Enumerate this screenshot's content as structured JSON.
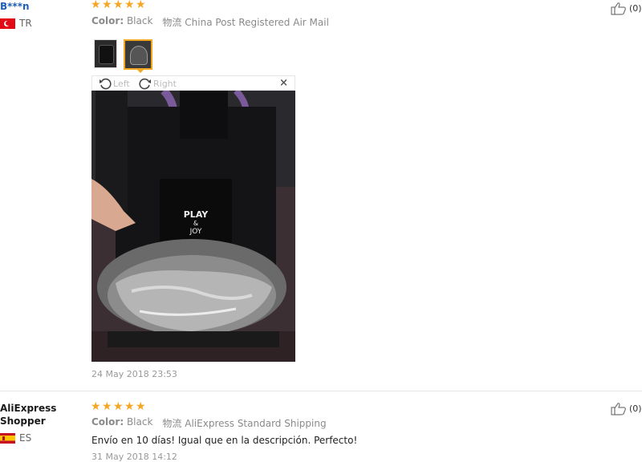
{
  "reviews": [
    {
      "user": "B***n",
      "country": "TR",
      "rating": 5,
      "color_label": "Color:",
      "color_value": "Black",
      "shipping_label": "物流",
      "shipping_value": "China Post Registered Air Mail",
      "rotate_left": "Left",
      "rotate_right": "Right",
      "close": "×",
      "photo_text": [
        "PLAY",
        "&",
        "JOY"
      ],
      "date": "24 May 2018 23:53",
      "helpful_count": "(0)"
    },
    {
      "user": "AliExpress Shopper",
      "country": "ES",
      "rating": 5,
      "color_label": "Color:",
      "color_value": "Black",
      "shipping_label": "物流",
      "shipping_value": "AliExpress Standard Shipping",
      "comment": "Envío en 10 días! Igual que en la descripción. Perfecto!",
      "date": "31 May 2018 14:12",
      "helpful_count": "(0)"
    }
  ],
  "colors": {
    "star": "#f5a623",
    "username": "#1f5fb8",
    "meta": "#8a8a8a"
  }
}
